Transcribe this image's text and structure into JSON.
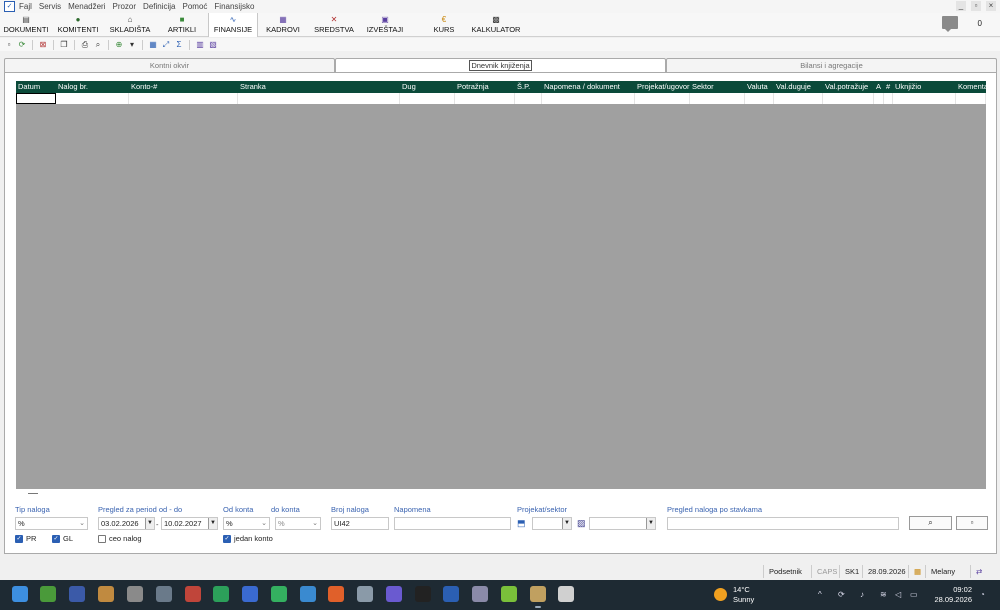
{
  "menu": {
    "items": [
      "Fajl",
      "Servis",
      "Menadžeri",
      "Prozor",
      "Definicija",
      "Pomoć",
      "Finansijsko"
    ]
  },
  "window_controls": [
    "_",
    "▫",
    "×"
  ],
  "modules": [
    {
      "label": "DOKUMENTI",
      "icon": "document-icon",
      "color": "#444"
    },
    {
      "label": "KOMITENTI",
      "icon": "person-icon",
      "color": "#2d6a2d"
    },
    {
      "label": "SKLADIŠTA",
      "icon": "warehouse-icon",
      "color": "#444"
    },
    {
      "label": "ARTIKLI",
      "icon": "article-icon",
      "color": "#3a8a3a"
    },
    {
      "label": "FINANSIJE",
      "icon": "chart-icon",
      "color": "#2b5fb3"
    },
    {
      "label": "KADROVI",
      "icon": "staff-icon",
      "color": "#5a3fa0"
    },
    {
      "label": "SREDSTVA",
      "icon": "tools-icon",
      "color": "#b03030"
    },
    {
      "label": "IZVEŠTAJI",
      "icon": "report-icon",
      "color": "#5a3fa0"
    },
    {
      "label": "KURS",
      "icon": "euro-icon",
      "color": "#c8860a"
    },
    {
      "label": "KALKULATOR",
      "icon": "calculator-icon",
      "color": "#333"
    }
  ],
  "notification_count": "0",
  "tabs": [
    "Kontni okvir",
    "Dnevnik knjiženja",
    "Bilansi i agregacije"
  ],
  "grid": {
    "columns": [
      "Datum",
      "Nalog br.",
      "Konto-#",
      "Stranka",
      "Dug",
      "Potražnja",
      "Š.P.",
      "Napomena / dokument",
      "Projekat/ugovor",
      "Sektor",
      "Valuta",
      "Val.duguje",
      "Val.potražuje",
      "A",
      "#",
      "Uknjižio",
      "Komentar"
    ]
  },
  "filters": {
    "tip_naloga_label": "Tip naloga",
    "tip_naloga_value": "%",
    "period_label": "Pregled za period od - do",
    "date_from": "03.02.2026",
    "date_to": "10.02.2027",
    "od_konta_label": "Od konta",
    "od_konta_value": "%",
    "do_konta_label": "do konta",
    "do_konta_value": "%",
    "broj_naloga_label": "Broj naloga",
    "broj_naloga_value": "UI42",
    "napomena_label": "Napomena",
    "napomena_value": "",
    "projekat_label": "Projekat/sektor",
    "pregled_label": "Pregled naloga po stavkama",
    "pr_label": "PR",
    "gl_label": "GL",
    "ceo_nalog_label": "ceo nalog",
    "jedan_konto_label": "jedan konto"
  },
  "status": {
    "podsetnik": "Podsetnik",
    "caps": "CAPS",
    "sk": "SK1",
    "date": "28.09.2026",
    "user": "Melany"
  },
  "taskbar": {
    "temperature": "14°C",
    "weather": "Sunny",
    "time": "09:02",
    "date": "28.09.2026"
  }
}
